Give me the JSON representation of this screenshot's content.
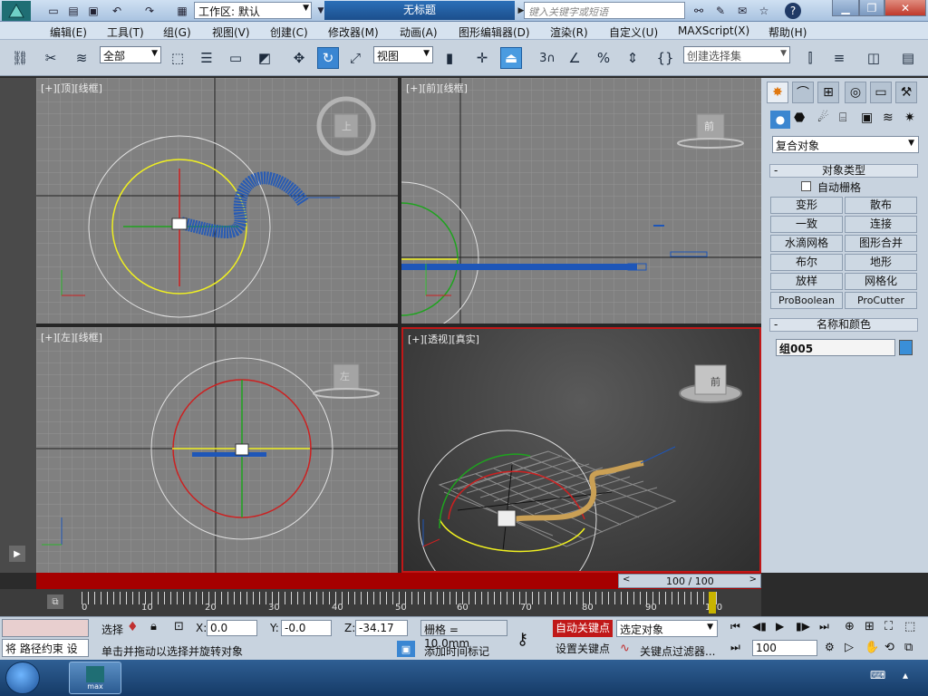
{
  "titlebar": {
    "workspace_label": "工作区: 默认",
    "doc_title": "无标题",
    "search_placeholder": "键入关键字或短语"
  },
  "menu": [
    "编辑(E)",
    "工具(T)",
    "组(G)",
    "视图(V)",
    "创建(C)",
    "修改器(M)",
    "动画(A)",
    "图形编辑器(D)",
    "渲染(R)",
    "自定义(U)",
    "MAXScript(X)",
    "帮助(H)"
  ],
  "toolbar": {
    "filter_select": "全部",
    "coord_select": "视图",
    "named_selection_placeholder": "创建选择集",
    "snap_label": "3"
  },
  "viewports": {
    "top": {
      "label": "[+][顶][线框]",
      "cube_label": "上"
    },
    "front": {
      "label": "[+][前][线框]",
      "cube_label": "前"
    },
    "left": {
      "label": "[+][左][线框]",
      "cube_label": "左"
    },
    "persp": {
      "label": "[+][透视][真实]",
      "cube_label": "前"
    }
  },
  "command_panel": {
    "category_select": "复合对象",
    "rollout_object_type": "对象类型",
    "auto_grid_label": "自动栅格",
    "object_buttons": [
      "变形",
      "散布",
      "一致",
      "连接",
      "水滴网格",
      "图形合并",
      "布尔",
      "地形",
      "放样",
      "网格化",
      "ProBoolean",
      "ProCutter"
    ],
    "rollout_name_color": "名称和颜色",
    "object_name": "组005",
    "object_color": "#3a8fd8"
  },
  "timeline": {
    "frame_display": "100 / 100",
    "ticks": [
      "0",
      "10",
      "20",
      "30",
      "40",
      "50",
      "60",
      "70",
      "80",
      "90",
      "100"
    ]
  },
  "status": {
    "script_line": "将 路径约束 设",
    "select_label": "选择",
    "x_value": "0.0",
    "y_value": "-0.0",
    "z_value": "-34.17",
    "grid_label": "栅格 = 10.0mm",
    "prompt": "单击并拖动以选择并旋转对象",
    "add_time_tag": "添加时间标记",
    "auto_key": "自动关键点",
    "set_key": "设置关键点",
    "key_mode_select": "选定对象",
    "key_filters": "关键点过滤器...",
    "current_frame": "100",
    "axis_x": "X:",
    "axis_y": "Y:",
    "axis_z": "Z:"
  },
  "taskbar": {
    "app_label": "max"
  }
}
